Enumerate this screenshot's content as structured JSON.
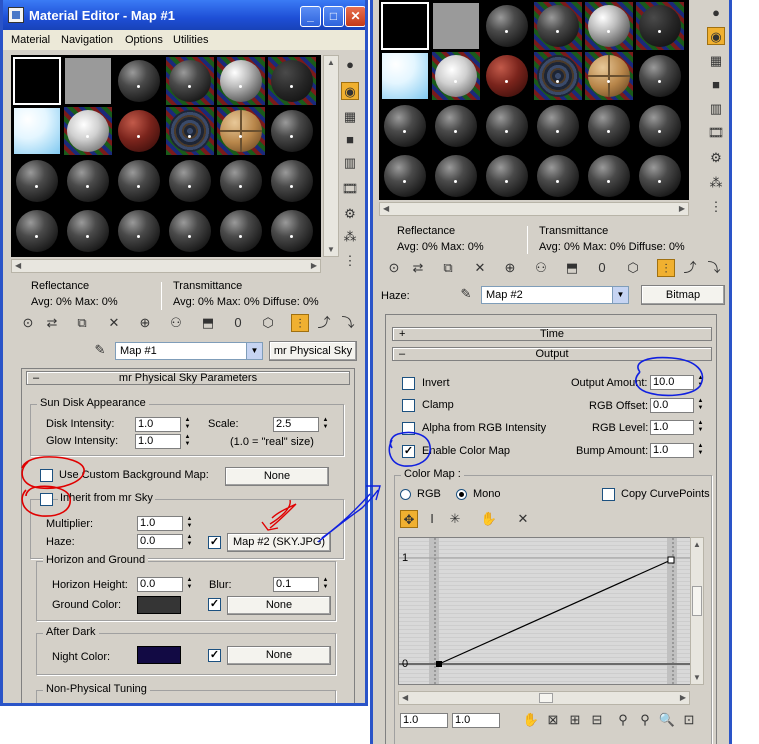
{
  "left_window": {
    "title": "Material Editor - Map #1",
    "menus": [
      "Material",
      "Navigation",
      "Options",
      "Utilities"
    ],
    "stats": {
      "reflectance_label": "Reflectance",
      "transmittance_label": "Transmittance",
      "refl_avg": "Avg:    0% Max:    0%",
      "trans_avg": "Avg:    0% Max:    0%  Diffuse:    0%"
    },
    "map_name": "Map #1",
    "map_type": "mr Physical Sky",
    "rollout_title": "mr Physical Sky Parameters",
    "sun_disk": {
      "label": "Sun Disk Appearance",
      "disk_intensity_label": "Disk Intensity:",
      "disk_intensity": "1.0",
      "glow_intensity_label": "Glow Intensity:",
      "glow_intensity": "1.0",
      "scale_label": "Scale:",
      "scale": "2.5",
      "real_size": "(1.0 = \"real\" size)"
    },
    "use_custom_bg_label": "Use Custom Background Map:",
    "custom_bg_map": "None",
    "inherit_label": "Inherit from mr Sky",
    "multiplier_label": "Multiplier:",
    "multiplier": "1.0",
    "haze_label": "Haze:",
    "haze": "0.0",
    "haze_map": "Map #2 (SKY.JPG)",
    "horizon": {
      "label": "Horizon and Ground",
      "height_label": "Horizon Height:",
      "height": "0.0",
      "blur_label": "Blur:",
      "blur": "0.1",
      "ground_color_label": "Ground Color:",
      "ground_map": "None"
    },
    "after_dark": {
      "label": "After Dark",
      "night_color_label": "Night Color:",
      "night_map": "None"
    },
    "non_physical_label": "Non-Physical Tuning"
  },
  "right_window": {
    "stats": {
      "reflectance_label": "Reflectance",
      "transmittance_label": "Transmittance",
      "refl_avg": "Avg:    0% Max:    0%",
      "trans_avg": "Avg:    0% Max:    0%  Diffuse:    0%"
    },
    "haze_label": "Haze:",
    "map_name": "Map #2",
    "map_type": "Bitmap",
    "time_rollout": "Time",
    "output_rollout": "Output",
    "invert_label": "Invert",
    "clamp_label": "Clamp",
    "alpha_label": "Alpha from RGB Intensity",
    "enable_color_map_label": "Enable Color Map",
    "output_amount_label": "Output Amount:",
    "output_amount": "10.0",
    "rgb_offset_label": "RGB Offset:",
    "rgb_offset": "0.0",
    "rgb_level_label": "RGB Level:",
    "rgb_level": "1.0",
    "bump_amount_label": "Bump Amount:",
    "bump_amount": "1.0",
    "color_map_label": "Color Map :",
    "rgb_label": "RGB",
    "mono_label": "Mono",
    "copy_curve_label": "Copy CurvePoints",
    "graph_y1": "1",
    "graph_y0": "0",
    "coord_x": "1.0",
    "coord_y": "1.0"
  },
  "colors": {
    "title_blue": "#1e4fd6",
    "panel": "#d4d0c8",
    "ground_color": "#353535",
    "night_color": "#120a44",
    "annotation_red": "#e00000",
    "annotation_blue": "#1020e0",
    "active_tool": "#f0b030"
  }
}
